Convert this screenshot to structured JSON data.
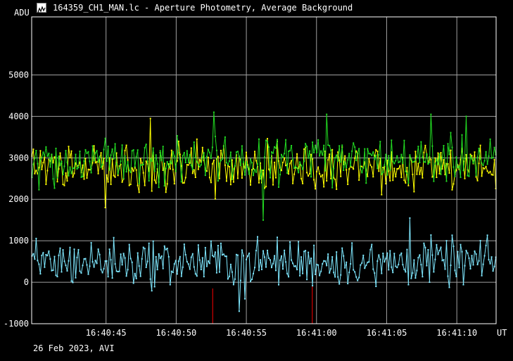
{
  "window": {
    "title": "164359_CH1_MAN.lc - Aperture Photometry, Average Background",
    "icon": "chart-app-icon"
  },
  "footer": {
    "date_label": "26 Feb 2023, AVI"
  },
  "chart_data": {
    "type": "line",
    "ylabel": "ADU",
    "xlabel": "UT",
    "ylim": [
      -1000,
      6400
    ],
    "xlim": [
      "16:40:39.7",
      "16:41:12.8"
    ],
    "y_ticks": [
      -1000,
      0,
      1000,
      2000,
      3000,
      4000,
      5000
    ],
    "y_tick_labels": [
      "-1000",
      "0",
      "1000",
      "2000",
      "3000",
      "4000",
      "5000"
    ],
    "x_ticks": [
      "16:40:45",
      "16:40:50",
      "16:40:55",
      "16:41:00",
      "16:41:05",
      "16:41:10"
    ],
    "x_tick_labels": [
      "16:40:45",
      "16:40:50",
      "16:40:55",
      "16:41:00",
      "16:41:05",
      "16:41:10"
    ],
    "grid": true,
    "series": [
      {
        "color": "#ffff00",
        "mean": 2750,
        "spread": 330,
        "clip": [
          1800,
          3950
        ],
        "keypoints": [
          [
            5.2,
            1800
          ],
          [
            8.5,
            3950
          ],
          [
            10.5,
            3400
          ],
          [
            19.5,
            3250
          ],
          [
            32.0,
            3300
          ]
        ]
      },
      {
        "color": "#22dd22",
        "mean": 2950,
        "spread": 330,
        "clip": [
          1500,
          4200
        ],
        "keypoints": [
          [
            13.0,
            4100
          ],
          [
            16.5,
            1500
          ],
          [
            21.0,
            4050
          ],
          [
            28.5,
            4050
          ],
          [
            31.0,
            4000
          ]
        ]
      },
      {
        "color": "#7fe8ff",
        "mean": 480,
        "spread": 340,
        "clip": [
          -700,
          1550
        ],
        "keypoints": [
          [
            14.8,
            -700
          ],
          [
            27.0,
            1550
          ],
          [
            15.2,
            -400
          ],
          [
            24.5,
            -100
          ]
        ]
      }
    ],
    "markers": [
      {
        "color": "#ff0000",
        "x": "16:40:52.6",
        "from": -1000,
        "to": -150
      },
      {
        "color": "#ff0000",
        "x": "16:40:59.7",
        "from": -1000,
        "to": -100
      }
    ]
  }
}
